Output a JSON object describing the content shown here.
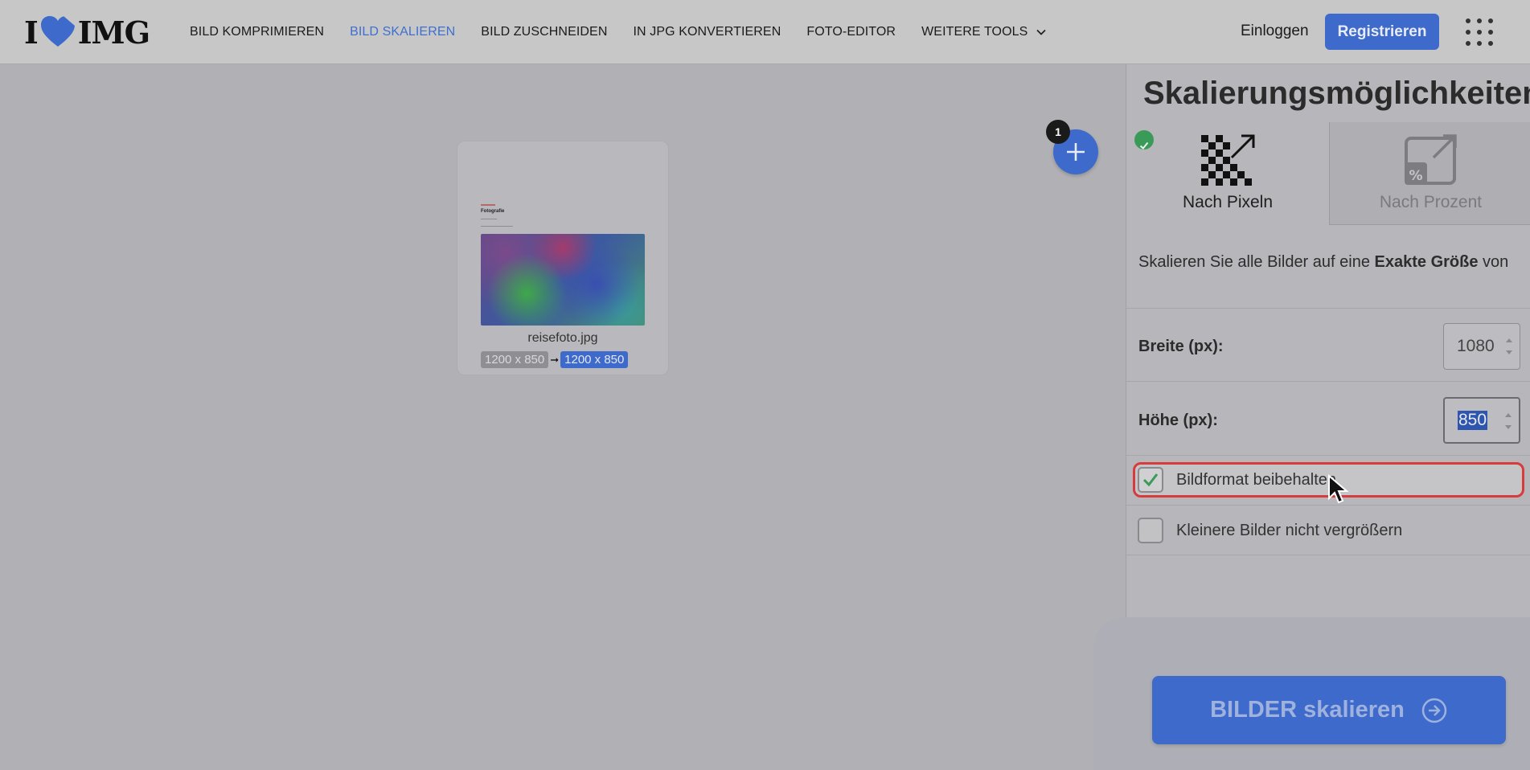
{
  "header": {
    "logo_text_left": "I",
    "logo_text_right": "IMG",
    "nav": [
      {
        "label": "BILD KOMPRIMIEREN",
        "active": false
      },
      {
        "label": "BILD SKALIEREN",
        "active": true
      },
      {
        "label": "BILD ZUSCHNEIDEN",
        "active": false
      },
      {
        "label": "IN JPG KONVERTIEREN",
        "active": false
      },
      {
        "label": "FOTO-EDITOR",
        "active": false
      },
      {
        "label": "WEITERE TOOLS",
        "active": false
      }
    ],
    "login_label": "Einloggen",
    "register_label": "Registrieren",
    "apps_icon": "grid-icon"
  },
  "workspace": {
    "file": {
      "name": "reisefoto.jpg",
      "doc_title": "Fotografie",
      "original_size": "1200 x 850",
      "new_size": "1200 x 850"
    },
    "add_badge_count": "1"
  },
  "sidebar": {
    "title": "Skalierungsmöglichkeiten",
    "tabs": [
      {
        "label": "Nach Pixeln",
        "selected": true
      },
      {
        "label": "Nach Prozent",
        "selected": false
      }
    ],
    "description_prefix": "Skalieren Sie alle Bilder auf eine ",
    "description_bold": "Exakte Größe",
    "description_suffix": " von",
    "width_label": "Breite (px):",
    "width_value": "1080",
    "height_label": "Höhe (px):",
    "height_value": "850",
    "keep_ratio_label": "Bildformat beibehalten",
    "keep_ratio_checked": true,
    "no_enlarge_label": "Kleinere Bilder nicht vergrößern",
    "no_enlarge_checked": false,
    "action_label": "BILDER skalieren"
  },
  "colors": {
    "accent": "#3d6acb",
    "check_green": "#3a9a58",
    "highlight_red": "#d83b3b"
  }
}
